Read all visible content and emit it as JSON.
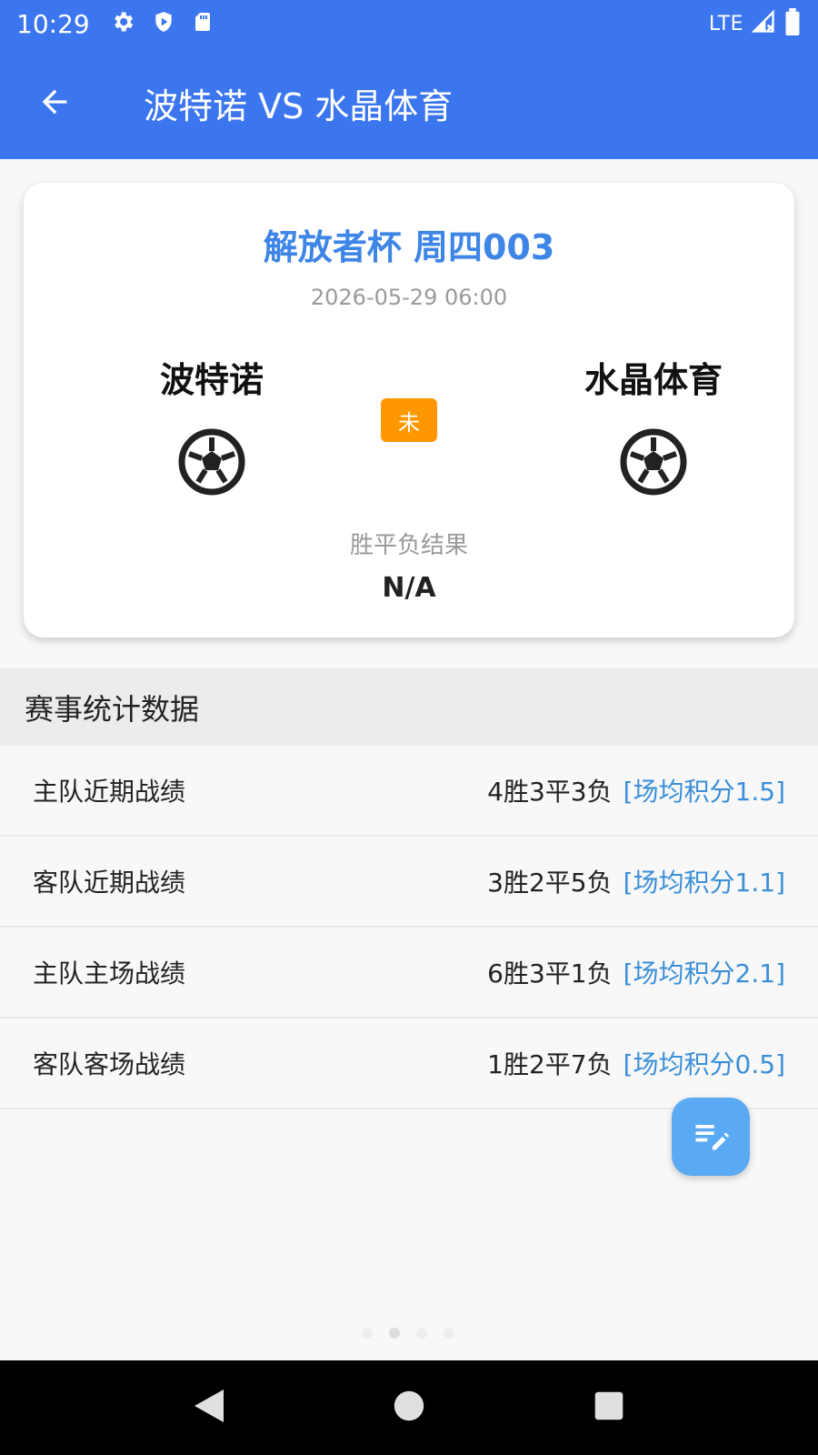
{
  "status_bar": {
    "time": "10:29",
    "network": "LTE",
    "icons": [
      "gear-icon",
      "shield-icon",
      "sd-card-icon",
      "signal-icon",
      "battery-icon"
    ]
  },
  "app_bar": {
    "title": "波特诺 VS 水晶体育",
    "back_icon": "arrow-left-icon"
  },
  "match": {
    "league": "解放者杯 周四003",
    "datetime": "2026-05-29 06:00",
    "home_team": "波特诺",
    "away_team": "水晶体育",
    "status": "未",
    "result_label": "胜平负结果",
    "result_value": "N/A"
  },
  "stats": {
    "title": "赛事统计数据",
    "rows": [
      {
        "label": "主队近期战绩",
        "record": "4胜3平3负",
        "avg": "[场均积分1.5]"
      },
      {
        "label": "客队近期战绩",
        "record": "3胜2平5负",
        "avg": "[场均积分1.1]"
      },
      {
        "label": "主队主场战绩",
        "record": "6胜3平1负",
        "avg": "[场均积分2.1]"
      },
      {
        "label": "客队客场战绩",
        "record": "1胜2平7负",
        "avg": "[场均积分0.5]"
      }
    ]
  },
  "colors": {
    "primary": "#3c76ee",
    "league_text": "#3d85e6",
    "badge": "#ff9800",
    "avg_text": "#3a8fd9",
    "fab": "#5aa9f3"
  }
}
